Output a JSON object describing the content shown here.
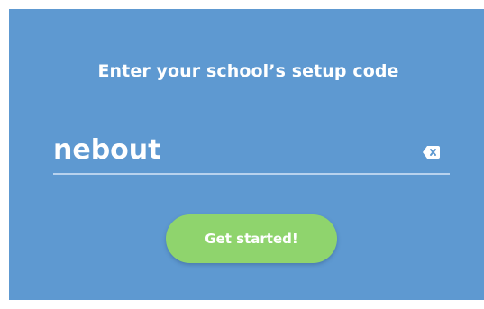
{
  "colors": {
    "background": "#5e99d1",
    "button": "#8fd46d",
    "text": "#ffffff",
    "underline": "#b8d2ee"
  },
  "heading": {
    "title": "Enter your school’s setup code"
  },
  "setup_code": {
    "value": "nebout",
    "clear_icon": "backspace-clear-icon"
  },
  "actions": {
    "start_label": "Get started!"
  }
}
